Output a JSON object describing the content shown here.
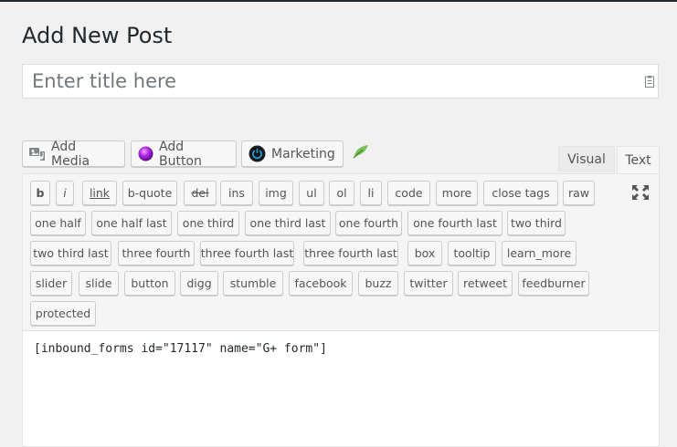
{
  "page": {
    "title": "Add New Post"
  },
  "title_field": {
    "value": "",
    "placeholder": "Enter title here"
  },
  "media_buttons": [
    {
      "label": "Add Media",
      "icon": "media-icon"
    },
    {
      "label": "Add Button",
      "icon": "purple-orb-icon"
    },
    {
      "label": "Marketing",
      "icon": "power-icon"
    }
  ],
  "extra_icon": "leaf-icon",
  "editor_tabs": {
    "visual": "Visual",
    "text": "Text",
    "active": "Text"
  },
  "quicktags": [
    "b",
    "i",
    "link",
    "b-quote",
    "del",
    "ins",
    "img",
    "ul",
    "ol",
    "li",
    "code",
    "more",
    "close tags",
    "raw",
    "one half",
    "one half last",
    "one third",
    "one third last",
    "one fourth",
    "one fourth last",
    "two third",
    "two third last",
    "three fourth",
    "three fourth last",
    "three fourth last",
    "box",
    "tooltip",
    "learn_more",
    "slider",
    "slide",
    "button",
    "digg",
    "stumble",
    "facebook",
    "buzz",
    "twitter",
    "retweet",
    "feedburner",
    "protected"
  ],
  "editor": {
    "content": "[inbound_forms id=\"17117\" name=\"G+ form\"]"
  },
  "colors": {
    "accent_purple": "#9b1fd6",
    "marketing_blue": "#1a9bd7",
    "leaf_green": "#6ab04c"
  }
}
